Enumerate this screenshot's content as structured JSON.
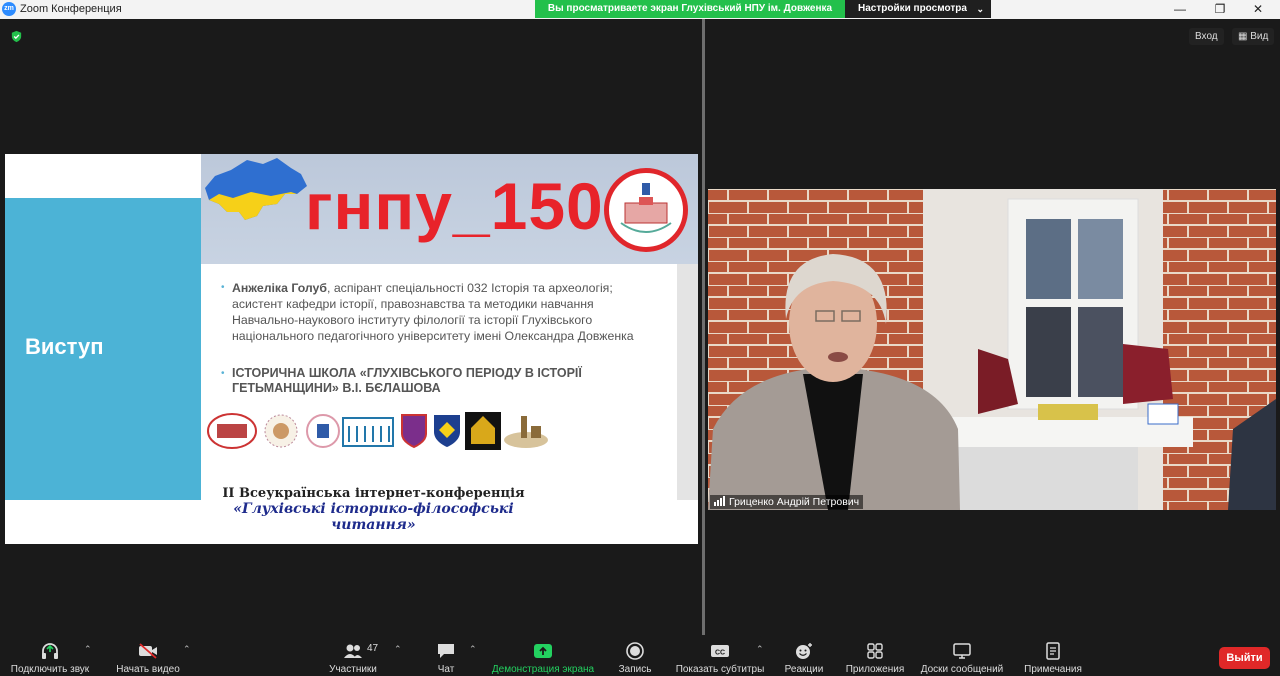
{
  "window": {
    "title": "Zoom Конференция",
    "logo": "zm"
  },
  "share_banner": "Вы просматриваете экран Глухівський НПУ ім. Довженка",
  "view_settings": {
    "label": "Настройки просмотра",
    "icon": "chevron-down-icon"
  },
  "top_right": {
    "enter": "Вход",
    "view": "Вид"
  },
  "slide": {
    "side_title": "Виступ",
    "banner_text": "гнпу_150",
    "speaker_name": "Анжеліка Голуб",
    "speaker_desc": ", аспірант спеціальності 032 Історія та археологія; асистент кафедри історії, правознавства та методики навчання Навчально-наукового інституту філології та історії Глухівського національного педагогічного університету імені Олександра Довженка",
    "talk_title": "ІСТОРИЧНА ШКОЛА «ГЛУХІВСЬКОГО ПЕРІОДУ В ІСТОРІЇ ГЕТЬМАНЩИНИ» В.І. БЄЛАШОВА",
    "conference_line1": "ІІ Всеукраїнська інтернет-конференція",
    "conference_line2": "«Глухівські історико-філософські",
    "conference_line3": "читання»"
  },
  "video": {
    "participant_name": "Гриценко Андрій Петрович"
  },
  "toolbar": {
    "audio": "Подключить звук",
    "video": "Начать видео",
    "participants": "Участники",
    "participants_count": "47",
    "chat": "Чат",
    "share": "Демонстрация экрана",
    "record": "Запись",
    "captions": "Показать субтитры",
    "reactions": "Реакции",
    "apps": "Приложения",
    "whiteboards": "Доски сообщений",
    "notes": "Примечания",
    "leave": "Выйти"
  },
  "colors": {
    "share_green": "#23c04b",
    "leave_red": "#e02828",
    "slide_blue": "#4cb3d6",
    "banner_red": "#e8232a"
  }
}
